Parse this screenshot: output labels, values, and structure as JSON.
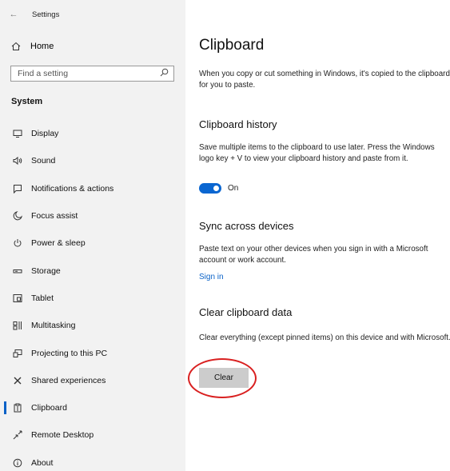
{
  "window": {
    "title": "Settings",
    "back_icon": "back-arrow-icon"
  },
  "sidebar": {
    "home_label": "Home",
    "search_placeholder": "Find a setting",
    "section_label": "System",
    "items": [
      {
        "label": "Display",
        "icon": "display-icon"
      },
      {
        "label": "Sound",
        "icon": "sound-icon"
      },
      {
        "label": "Notifications & actions",
        "icon": "notifications-icon"
      },
      {
        "label": "Focus assist",
        "icon": "moon-icon"
      },
      {
        "label": "Power & sleep",
        "icon": "power-icon"
      },
      {
        "label": "Storage",
        "icon": "storage-icon"
      },
      {
        "label": "Tablet",
        "icon": "tablet-icon"
      },
      {
        "label": "Multitasking",
        "icon": "multitasking-icon"
      },
      {
        "label": "Projecting to this PC",
        "icon": "projecting-icon"
      },
      {
        "label": "Shared experiences",
        "icon": "shared-experiences-icon"
      },
      {
        "label": "Clipboard",
        "icon": "clipboard-icon",
        "active": true
      },
      {
        "label": "Remote Desktop",
        "icon": "remote-desktop-icon"
      },
      {
        "label": "About",
        "icon": "info-icon"
      }
    ]
  },
  "main": {
    "title": "Clipboard",
    "intro": "When you copy or cut something in Windows, it's copied to the clipboard for you to paste.",
    "history": {
      "heading": "Clipboard history",
      "description": "Save multiple items to the clipboard to use later. Press the Windows logo key + V to view your clipboard history and paste from it.",
      "toggle_state": "On"
    },
    "sync": {
      "heading": "Sync across devices",
      "description": "Paste text on your other devices when you sign in with a Microsoft account or work account.",
      "link": "Sign in"
    },
    "clear": {
      "heading": "Clear clipboard data",
      "description": "Clear everything (except pinned items) on this device and with Microsoft.",
      "button": "Clear"
    }
  },
  "colors": {
    "accent": "#0a62c7",
    "sidebar_bg": "#f2f2f2",
    "annotation_ring": "#d92020"
  }
}
